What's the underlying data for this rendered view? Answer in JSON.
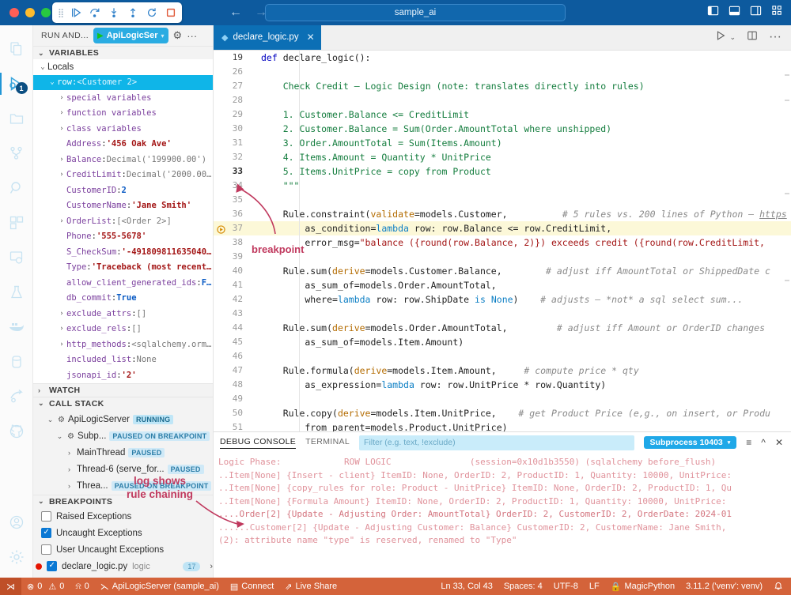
{
  "titlebar": {
    "window_title": "sample_ai",
    "debug_toolbar": [
      {
        "name": "drag-handle",
        "glyph": "⣿"
      },
      {
        "name": "continue-icon",
        "glyph": "▷|"
      },
      {
        "name": "step-over-icon",
        "glyph": "↷"
      },
      {
        "name": "step-into-icon",
        "glyph": "↓"
      },
      {
        "name": "step-out-icon",
        "glyph": "↑"
      },
      {
        "name": "restart-icon",
        "glyph": "↺"
      },
      {
        "name": "stop-icon",
        "glyph": "□"
      }
    ],
    "back_glyph": "←",
    "forward_glyph": "→",
    "layout_icons": [
      "◧",
      "▤",
      "◫",
      "⠿"
    ]
  },
  "activitybar": {
    "items": [
      {
        "name": "explorer-icon",
        "glyph": "🗎",
        "active": false,
        "badge": null
      },
      {
        "name": "run-and-debug-icon",
        "glyph": "▷",
        "active": true,
        "badge": "1"
      },
      {
        "name": "source-control-folder-icon",
        "glyph": "🗀",
        "active": false,
        "badge": null
      },
      {
        "name": "source-control-icon",
        "glyph": "⑂",
        "active": false,
        "badge": null
      },
      {
        "name": "search-icon",
        "glyph": "🔍",
        "active": false,
        "badge": null
      },
      {
        "name": "extensions-icon",
        "glyph": "⬓",
        "active": false,
        "badge": null
      },
      {
        "name": "remote-explorer-icon",
        "glyph": "🖵",
        "active": false,
        "badge": null
      },
      {
        "name": "testing-icon",
        "glyph": "⚗",
        "active": false,
        "badge": null
      },
      {
        "name": "docker-icon",
        "glyph": "🐳",
        "active": false,
        "badge": null
      },
      {
        "name": "database-icon",
        "glyph": "🗄",
        "active": false,
        "badge": null
      },
      {
        "name": "share-icon",
        "glyph": "⇗",
        "active": false,
        "badge": null
      },
      {
        "name": "github-icon",
        "glyph": "◉",
        "active": false,
        "badge": null
      }
    ],
    "bottom_items": [
      {
        "name": "accounts-icon",
        "glyph": "◍"
      },
      {
        "name": "settings-gear-icon",
        "glyph": "⚙"
      }
    ]
  },
  "sidebar": {
    "header": {
      "title": "RUN AND...",
      "config_name": "ApiLogicSer",
      "gear_glyph": "⚙",
      "more_glyph": "···"
    },
    "variables": {
      "title": "VARIABLES",
      "scope": "Locals",
      "rows": [
        {
          "indent": 1,
          "twisty": "v",
          "key": "row",
          "sep": ":",
          "value": "<Customer 2>",
          "valtype": "dim",
          "selected": true
        },
        {
          "indent": 2,
          "twisty": ">",
          "key": "special variables",
          "sep": "",
          "value": "",
          "valtype": "dim",
          "selected": false
        },
        {
          "indent": 2,
          "twisty": ">",
          "key": "function variables",
          "sep": "",
          "value": "",
          "valtype": "dim",
          "selected": false
        },
        {
          "indent": 2,
          "twisty": ">",
          "key": "class variables",
          "sep": "",
          "value": "",
          "valtype": "dim",
          "selected": false
        },
        {
          "indent": 2,
          "twisty": "",
          "key": "Address",
          "sep": ":",
          "value": "'456 Oak Ave'",
          "valtype": "str",
          "selected": false
        },
        {
          "indent": 2,
          "twisty": ">",
          "key": "Balance",
          "sep": ":",
          "value": "Decimal('199900.00')",
          "valtype": "dim",
          "selected": false
        },
        {
          "indent": 2,
          "twisty": ">",
          "key": "CreditLimit",
          "sep": ":",
          "value": "Decimal('2000.00…",
          "valtype": "dim",
          "selected": false
        },
        {
          "indent": 2,
          "twisty": "",
          "key": "CustomerID",
          "sep": ":",
          "value": "2",
          "valtype": "num",
          "selected": false
        },
        {
          "indent": 2,
          "twisty": "",
          "key": "CustomerName",
          "sep": ":",
          "value": "'Jane Smith'",
          "valtype": "str",
          "selected": false
        },
        {
          "indent": 2,
          "twisty": ">",
          "key": "OrderList",
          "sep": ":",
          "value": "[<Order 2>]",
          "valtype": "dim",
          "selected": false
        },
        {
          "indent": 2,
          "twisty": "",
          "key": "Phone",
          "sep": ":",
          "value": "'555-5678'",
          "valtype": "str",
          "selected": false
        },
        {
          "indent": 2,
          "twisty": "",
          "key": "S_CheckSum",
          "sep": ":",
          "value": "'-491809811635040…",
          "valtype": "str",
          "selected": false
        },
        {
          "indent": 2,
          "twisty": "",
          "key": "Type",
          "sep": ":",
          "value": "'Traceback (most recent…",
          "valtype": "str",
          "selected": false
        },
        {
          "indent": 2,
          "twisty": "",
          "key": "allow_client_generated_ids",
          "sep": ":",
          "value": "F…",
          "valtype": "kw",
          "selected": false
        },
        {
          "indent": 2,
          "twisty": "",
          "key": "db_commit",
          "sep": ":",
          "value": "True",
          "valtype": "kw",
          "selected": false
        },
        {
          "indent": 2,
          "twisty": ">",
          "key": "exclude_attrs",
          "sep": ":",
          "value": "[]",
          "valtype": "dim",
          "selected": false
        },
        {
          "indent": 2,
          "twisty": ">",
          "key": "exclude_rels",
          "sep": ":",
          "value": "[]",
          "valtype": "dim",
          "selected": false
        },
        {
          "indent": 2,
          "twisty": ">",
          "key": "http_methods",
          "sep": ":",
          "value": "<sqlalchemy.orm…",
          "valtype": "dim",
          "selected": false
        },
        {
          "indent": 2,
          "twisty": "",
          "key": "included_list",
          "sep": ":",
          "value": "None",
          "valtype": "dim",
          "selected": false
        },
        {
          "indent": 2,
          "twisty": "",
          "key": "jsonapi_id",
          "sep": ":",
          "value": "'2'",
          "valtype": "str",
          "selected": false
        }
      ]
    },
    "watch": {
      "title": "WATCH"
    },
    "callstack": {
      "title": "CALL STACK",
      "rows": [
        {
          "indent": 1,
          "twisty": "v",
          "icon": "⚙",
          "label": "ApiLogicServer",
          "tag": "RUNNING"
        },
        {
          "indent": 2,
          "twisty": "v",
          "icon": "⚙",
          "label": "Subp...",
          "tag": "PAUSED ON BREAKPOINT"
        },
        {
          "indent": 3,
          "twisty": ">",
          "icon": "",
          "label": "MainThread",
          "tag": "PAUSED"
        },
        {
          "indent": 3,
          "twisty": ">",
          "icon": "",
          "label": "Thread-6 (serve_for...",
          "tag": "PAUSED"
        },
        {
          "indent": 3,
          "twisty": ">",
          "icon": "",
          "label": "Threa...",
          "tag": "PAUSED ON BREAKPOINT"
        }
      ]
    },
    "breakpoints": {
      "title": "BREAKPOINTS",
      "rows": [
        {
          "checked": false,
          "bpdot": false,
          "label": "Raised Exceptions",
          "sub": "",
          "count": ""
        },
        {
          "checked": true,
          "bpdot": false,
          "label": "Uncaught Exceptions",
          "sub": "",
          "count": ""
        },
        {
          "checked": false,
          "bpdot": false,
          "label": "User Uncaught Exceptions",
          "sub": "",
          "count": ""
        },
        {
          "checked": true,
          "bpdot": true,
          "label": "declare_logic.py",
          "sub": "logic",
          "count": "17"
        }
      ]
    }
  },
  "editor": {
    "tab": {
      "label": "declare_logic.py",
      "close_glyph": "✕",
      "modified_glyph": "◆"
    },
    "tab_actions": [
      "▷",
      "⌄",
      "◫",
      "···"
    ],
    "lines": [
      {
        "n": "19",
        "hl": false,
        "bp": false,
        "cur": false,
        "topsel": true,
        "tokens": [
          {
            "t": "def ",
            "c": "kw"
          },
          {
            "t": "declare_logic():",
            "c": "fn"
          }
        ]
      },
      {
        "n": "26",
        "hl": false,
        "bp": false,
        "cur": false,
        "topsel": false,
        "tokens": []
      },
      {
        "n": "27",
        "hl": false,
        "bp": false,
        "cur": false,
        "topsel": false,
        "tokens": [
          {
            "t": "    Check Credit – Logic Design (note: translates directly into rules)",
            "c": "doc"
          }
        ]
      },
      {
        "n": "28",
        "hl": false,
        "bp": false,
        "cur": false,
        "topsel": false,
        "tokens": []
      },
      {
        "n": "29",
        "hl": false,
        "bp": false,
        "cur": false,
        "topsel": false,
        "tokens": [
          {
            "t": "    1. Customer.Balance <= CreditLimit",
            "c": "doc"
          }
        ]
      },
      {
        "n": "30",
        "hl": false,
        "bp": false,
        "cur": false,
        "topsel": false,
        "tokens": [
          {
            "t": "    2. Customer.Balance = Sum(Order.AmountTotal where unshipped)",
            "c": "doc"
          }
        ]
      },
      {
        "n": "31",
        "hl": false,
        "bp": false,
        "cur": false,
        "topsel": false,
        "tokens": [
          {
            "t": "    3. Order.AmountTotal = Sum(Items.Amount)",
            "c": "doc"
          }
        ]
      },
      {
        "n": "32",
        "hl": false,
        "bp": false,
        "cur": false,
        "topsel": false,
        "tokens": [
          {
            "t": "    4. Items.Amount = Quantity * UnitPrice",
            "c": "doc"
          }
        ]
      },
      {
        "n": "33",
        "hl": false,
        "bp": false,
        "cur": true,
        "topsel": false,
        "tokens": [
          {
            "t": "    5. Items.UnitPrice = copy from Product",
            "c": "doc"
          }
        ]
      },
      {
        "n": "34",
        "hl": false,
        "bp": false,
        "cur": false,
        "topsel": false,
        "tokens": [
          {
            "t": "    \"\"\"",
            "c": "doc"
          }
        ]
      },
      {
        "n": "35",
        "hl": false,
        "bp": false,
        "cur": false,
        "topsel": false,
        "tokens": []
      },
      {
        "n": "36",
        "hl": false,
        "bp": false,
        "cur": false,
        "topsel": false,
        "tokens": [
          {
            "t": "    Rule.constraint(",
            "c": "plain"
          },
          {
            "t": "validate",
            "c": "arg"
          },
          {
            "t": "=models.Customer,",
            "c": "plain"
          },
          {
            "t": "          # 5 rules vs. 200 lines of Python – ",
            "c": "cmt"
          },
          {
            "t": "https",
            "c": "cmtlink"
          }
        ]
      },
      {
        "n": "37",
        "hl": true,
        "bp": true,
        "cur": false,
        "topsel": false,
        "tokens": [
          {
            "t": "        as_condition=",
            "c": "plain"
          },
          {
            "t": "lambda",
            "c": "kw2"
          },
          {
            "t": " row: row.Balance ",
            "c": "plain"
          },
          {
            "t": "<=",
            "c": "op"
          },
          {
            "t": " row.CreditLimit,",
            "c": "plain"
          }
        ]
      },
      {
        "n": "38",
        "hl": false,
        "bp": false,
        "cur": false,
        "topsel": false,
        "tokens": [
          {
            "t": "        error_msg=",
            "c": "plain"
          },
          {
            "t": "\"balance ({round(row.Balance, 2)}) exceeds credit ({round(row.CreditLimit,",
            "c": "str"
          }
        ]
      },
      {
        "n": "39",
        "hl": false,
        "bp": false,
        "cur": false,
        "topsel": false,
        "tokens": []
      },
      {
        "n": "40",
        "hl": false,
        "bp": false,
        "cur": false,
        "topsel": false,
        "tokens": [
          {
            "t": "    Rule.sum(",
            "c": "plain"
          },
          {
            "t": "derive",
            "c": "arg"
          },
          {
            "t": "=models.Customer.Balance,",
            "c": "plain"
          },
          {
            "t": "        # adjust iff AmountTotal or ShippedDate c",
            "c": "cmt"
          }
        ]
      },
      {
        "n": "41",
        "hl": false,
        "bp": false,
        "cur": false,
        "topsel": false,
        "tokens": [
          {
            "t": "        as_sum_of=models.Order.AmountTotal,",
            "c": "plain"
          }
        ]
      },
      {
        "n": "42",
        "hl": false,
        "bp": false,
        "cur": false,
        "topsel": false,
        "tokens": [
          {
            "t": "        where=",
            "c": "plain"
          },
          {
            "t": "lambda",
            "c": "kw2"
          },
          {
            "t": " row: row.ShipDate ",
            "c": "plain"
          },
          {
            "t": "is",
            "c": "kw2"
          },
          {
            "t": " ",
            "c": "plain"
          },
          {
            "t": "None",
            "c": "kw2"
          },
          {
            "t": ")",
            "c": "plain"
          },
          {
            "t": "    # adjusts – *not* a sql select sum...",
            "c": "cmt"
          }
        ]
      },
      {
        "n": "43",
        "hl": false,
        "bp": false,
        "cur": false,
        "topsel": false,
        "tokens": []
      },
      {
        "n": "44",
        "hl": false,
        "bp": false,
        "cur": false,
        "topsel": false,
        "tokens": [
          {
            "t": "    Rule.sum(",
            "c": "plain"
          },
          {
            "t": "derive",
            "c": "arg"
          },
          {
            "t": "=models.Order.AmountTotal,",
            "c": "plain"
          },
          {
            "t": "         # adjust iff Amount or OrderID changes",
            "c": "cmt"
          }
        ]
      },
      {
        "n": "45",
        "hl": false,
        "bp": false,
        "cur": false,
        "topsel": false,
        "tokens": [
          {
            "t": "        as_sum_of=models.Item.Amount)",
            "c": "plain"
          }
        ]
      },
      {
        "n": "46",
        "hl": false,
        "bp": false,
        "cur": false,
        "topsel": false,
        "tokens": []
      },
      {
        "n": "47",
        "hl": false,
        "bp": false,
        "cur": false,
        "topsel": false,
        "tokens": [
          {
            "t": "    Rule.formula(",
            "c": "plain"
          },
          {
            "t": "derive",
            "c": "arg"
          },
          {
            "t": "=models.Item.Amount,",
            "c": "plain"
          },
          {
            "t": "     # compute price * qty",
            "c": "cmt"
          }
        ]
      },
      {
        "n": "48",
        "hl": false,
        "bp": false,
        "cur": false,
        "topsel": false,
        "tokens": [
          {
            "t": "        as_expression=",
            "c": "plain"
          },
          {
            "t": "lambda",
            "c": "kw2"
          },
          {
            "t": " row: row.UnitPrice * row.Quantity)",
            "c": "plain"
          }
        ]
      },
      {
        "n": "49",
        "hl": false,
        "bp": false,
        "cur": false,
        "topsel": false,
        "tokens": []
      },
      {
        "n": "50",
        "hl": false,
        "bp": false,
        "cur": false,
        "topsel": false,
        "tokens": [
          {
            "t": "    Rule.copy(",
            "c": "plain"
          },
          {
            "t": "derive",
            "c": "arg"
          },
          {
            "t": "=models.Item.UnitPrice,",
            "c": "plain"
          },
          {
            "t": "    # get Product Price (e,g., on insert, or Produ",
            "c": "cmt"
          }
        ]
      },
      {
        "n": "51",
        "hl": false,
        "bp": false,
        "cur": false,
        "topsel": false,
        "tokens": [
          {
            "t": "        from_parent=models.Product.UnitPrice)",
            "c": "plain"
          }
        ]
      },
      {
        "n": "52",
        "hl": false,
        "bp": false,
        "cur": false,
        "topsel": false,
        "tokens": []
      }
    ]
  },
  "panel": {
    "tabs": [
      {
        "label": "DEBUG CONSOLE",
        "active": true
      },
      {
        "label": "TERMINAL",
        "active": false
      }
    ],
    "filter_placeholder": "Filter (e.g. text, !exclude)",
    "selector": "Subprocess 10403",
    "icons": [
      "≡",
      "^",
      "✕"
    ],
    "lines": [
      {
        "text": "Logic Phase:\t\tROW LOGIC\t\t(session=0x10d1b3550) (sqlalchemy before_flush)",
        "strong": false
      },
      {
        "text": "..Item[None] {Insert - client} ItemID: None, OrderID: 2, ProductID: 1, Quantity: 10000, UnitPrice:",
        "strong": false
      },
      {
        "text": "..Item[None] {copy_rules for role: Product - UnitPrice} ItemID: None, OrderID: 2, ProductID: 1, Qu",
        "strong": false
      },
      {
        "text": "..Item[None] {Formula Amount} ItemID: None, OrderID: 2, ProductID: 1, Quantity: 10000, UnitPrice:",
        "strong": false
      },
      {
        "text": "....Order[2] {Update - Adjusting Order: AmountTotal} OrderID: 2, CustomerID: 2, OrderDate: 2024-01",
        "strong": true
      },
      {
        "text": "......Customer[2] {Update - Adjusting Customer: Balance} CustomerID: 2, CustomerName: Jane Smith,",
        "strong": false
      },
      {
        "text": "(2): attribute name \"type\" is reserved, renamed to \"Type\"",
        "strong": false
      }
    ]
  },
  "statusbar": {
    "remote_glyph": "⋊",
    "errors": "0",
    "warnings": "0",
    "ports": "0",
    "debug_session": "ApiLogicServer (sample_ai)",
    "connect": "Connect",
    "live_share": "Live Share",
    "position": "Ln 33, Col 43",
    "indent": "Spaces: 4",
    "encoding": "UTF-8",
    "eol": "LF",
    "language": "MagicPython",
    "interpreter": "3.11.2 ('venv': venv)",
    "bell_glyph": "🔔"
  },
  "annotations": {
    "breakpoint_label": "breakpoint",
    "log_label_line1": "log shows",
    "log_label_line2": "rule chaining",
    "accent": "#c0395e"
  }
}
